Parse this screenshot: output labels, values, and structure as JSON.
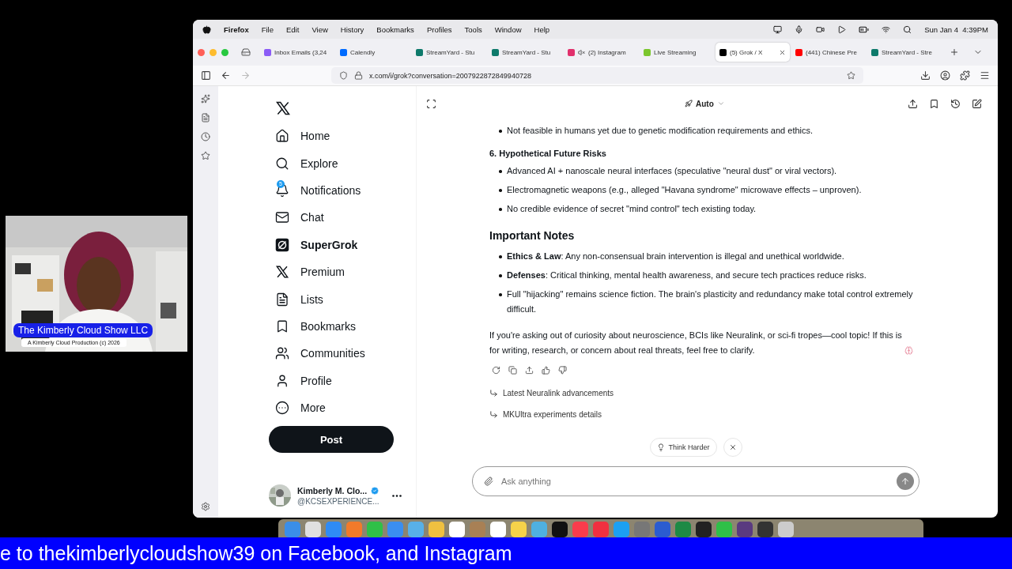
{
  "menu_bar": {
    "app": "Firefox",
    "items": [
      "File",
      "Edit",
      "View",
      "History",
      "Bookmarks",
      "Profiles",
      "Tools",
      "Window",
      "Help"
    ],
    "clock": "Sun Jan 4  4:39PM"
  },
  "tabs": [
    {
      "label": "Inbox Emails (3,24",
      "kind": "mail",
      "selected": false
    },
    {
      "label": "Calendly",
      "kind": "calendly",
      "selected": false
    },
    {
      "label": "StreamYard - Stu",
      "kind": "streamyard",
      "selected": false
    },
    {
      "label": "StreamYard - Stu",
      "kind": "streamyard",
      "selected": false
    },
    {
      "label": "(2) Instagram",
      "kind": "instagram",
      "selected": false
    },
    {
      "label": "Live Streaming",
      "kind": "live",
      "selected": false
    },
    {
      "label": "(5) Grok / X",
      "kind": "x",
      "selected": true
    },
    {
      "label": "(441) Chinese Pre",
      "kind": "youtube",
      "selected": false
    },
    {
      "label": "StreamYard - Stre",
      "kind": "streamyard",
      "selected": false
    }
  ],
  "address": "x.com/i/grok?conversation=2007922872849940728",
  "nav": [
    {
      "label": "Home",
      "kind": "home",
      "selected": false
    },
    {
      "label": "Explore",
      "kind": "explore",
      "selected": false
    },
    {
      "label": "Notifications",
      "kind": "notifications",
      "selected": false,
      "badge": "5"
    },
    {
      "label": "Chat",
      "kind": "chat",
      "selected": false
    },
    {
      "label": "SuperGrok",
      "kind": "grok",
      "selected": true
    },
    {
      "label": "Premium",
      "kind": "premium",
      "selected": false
    },
    {
      "label": "Lists",
      "kind": "lists",
      "selected": false
    },
    {
      "label": "Bookmarks",
      "kind": "bookmarks",
      "selected": false
    },
    {
      "label": "Communities",
      "kind": "communities",
      "selected": false
    },
    {
      "label": "Profile",
      "kind": "profile",
      "selected": false
    },
    {
      "label": "More",
      "kind": "more",
      "selected": false
    }
  ],
  "post_button": "Post",
  "account": {
    "name": "Kimberly M. Clo...",
    "handle": "@KCSEXPERIENCE..."
  },
  "model": "Auto",
  "message": [
    {
      "kind": "bullet",
      "text": "Not feasible in humans yet due to genetic modification requirements and ethics."
    },
    {
      "kind": "subheading",
      "text": "6. Hypothetical Future Risks"
    },
    {
      "kind": "bullet",
      "text": "Advanced AI + nanoscale neural interfaces (speculative \"neural dust\" or viral vectors)."
    },
    {
      "kind": "bullet",
      "text": "Electromagnetic weapons (e.g., alleged \"Havana syndrome\" microwave effects – unproven)."
    },
    {
      "kind": "bullet",
      "text": "No credible evidence of secret \"mind control\" tech existing today."
    },
    {
      "kind": "heading",
      "text": "Important Notes"
    },
    {
      "kind": "bullet",
      "text": "**Ethics & Law**: Any non-consensual brain intervention is illegal and unethical worldwide."
    },
    {
      "kind": "bullet",
      "text": "**Defenses**: Critical thinking, mental health awareness, and secure tech practices reduce risks."
    },
    {
      "kind": "bullet",
      "text": "Full \"hijacking\" remains science fiction. The brain's plasticity and redundancy make total control extremely difficult."
    },
    {
      "kind": "paragraph",
      "text": "If you're asking out of curiosity about neuroscience, BCIs like Neuralink, or sci-fi tropes—cool topic! If this is for writing, research, or concern about real threats, feel free to clarify."
    }
  ],
  "suggestions": [
    "Latest Neuralink advancements",
    "MKUltra experiments details"
  ],
  "think_harder": "Think Harder",
  "input": {
    "placeholder": "Ask anything"
  },
  "webcam": {
    "kind": "picture",
    "title": "The Kimberly Cloud Show LLC",
    "subtitle": "A Kimberly Cloud Production (c) 2026"
  },
  "ticker": "e to thekimberlycloudshow39 on Facebook, and Instagram"
}
